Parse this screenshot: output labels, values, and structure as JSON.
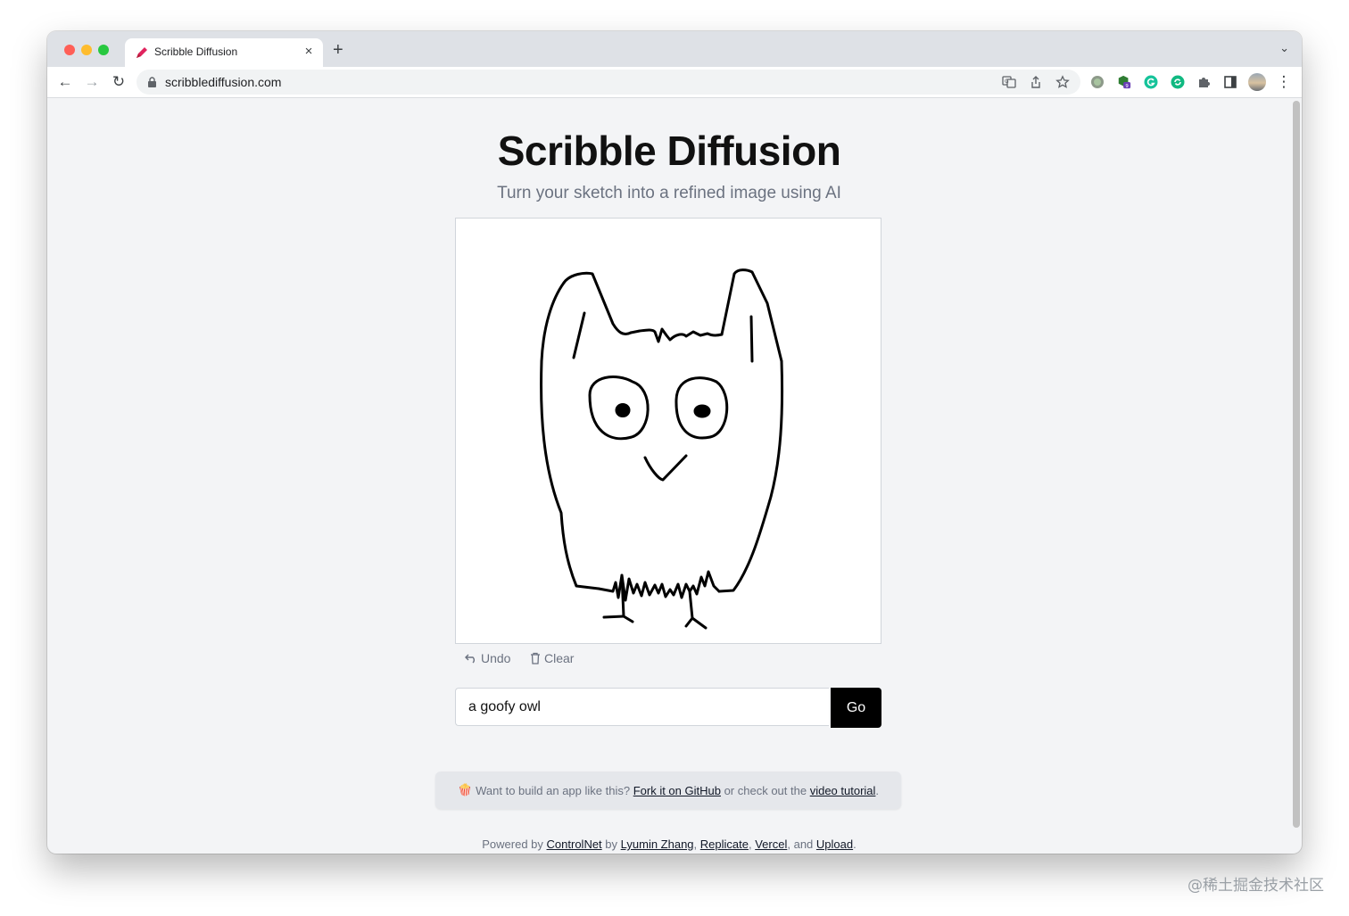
{
  "browser": {
    "tab_title": "Scribble Diffusion",
    "tab_close": "×",
    "new_tab": "+",
    "tab_list": "⌄",
    "back": "←",
    "forward": "→",
    "reload": "↻",
    "url": "scribblediffusion.com",
    "extension_badge": "9",
    "menu": "⋮"
  },
  "page": {
    "title": "Scribble Diffusion",
    "subtitle": "Turn your sketch into a refined image using AI",
    "undo_label": "Undo",
    "clear_label": "Clear",
    "prompt_value": "a goofy owl",
    "go_label": "Go",
    "callout": {
      "emoji": "🍿",
      "text_before": "Want to build an app like this? ",
      "github_link": "Fork it on GitHub",
      "text_middle": " or check out the ",
      "tutorial_link": "video tutorial",
      "text_after": "."
    },
    "footer": {
      "prefix": "Powered by ",
      "controlnet": "ControlNet",
      "by": " by ",
      "author": "Lyumin Zhang",
      "sep1": ", ",
      "replicate": "Replicate",
      "sep2": ", ",
      "vercel": "Vercel",
      "and": ", and ",
      "upload": "Upload",
      "end": "."
    }
  },
  "watermark": "@稀土掘金技术社区",
  "colors": {
    "page_bg": "#f3f4f6",
    "go_button": "#000000",
    "callout_bg": "#e5e7eb",
    "muted_text": "#6b7280"
  },
  "icons": [
    "pencil-favicon-icon",
    "lock-icon",
    "translate-icon",
    "share-icon",
    "star-icon",
    "extension-icons",
    "puzzle-icon",
    "sidepanel-icon",
    "profile-avatar",
    "undo-icon",
    "trash-icon"
  ]
}
